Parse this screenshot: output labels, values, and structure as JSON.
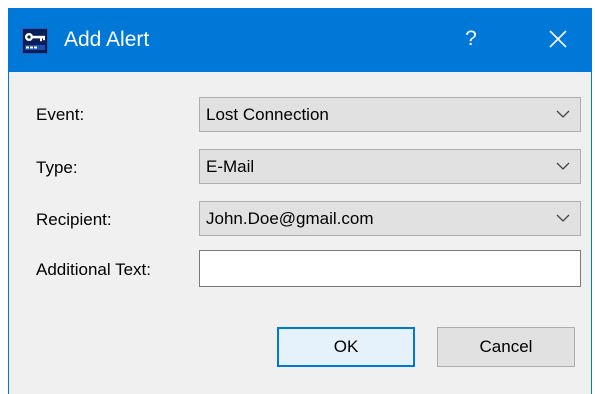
{
  "window": {
    "title": "Add Alert",
    "help_glyph": "?",
    "icons": {
      "app": "app-key-icon",
      "close": "close-icon"
    },
    "colors": {
      "titlebar": "#0078d7",
      "dialog_bg": "#f0f0f0",
      "default_button_border": "#0078d7"
    }
  },
  "form": {
    "event": {
      "label": "Event:",
      "value": "Lost Connection"
    },
    "type": {
      "label": "Type:",
      "value": "E-Mail"
    },
    "recipient": {
      "label": "Recipient:",
      "value": "John.Doe@gmail.com"
    },
    "additional_text": {
      "label": "Additional Text:",
      "value": ""
    }
  },
  "buttons": {
    "ok": "OK",
    "cancel": "Cancel"
  }
}
